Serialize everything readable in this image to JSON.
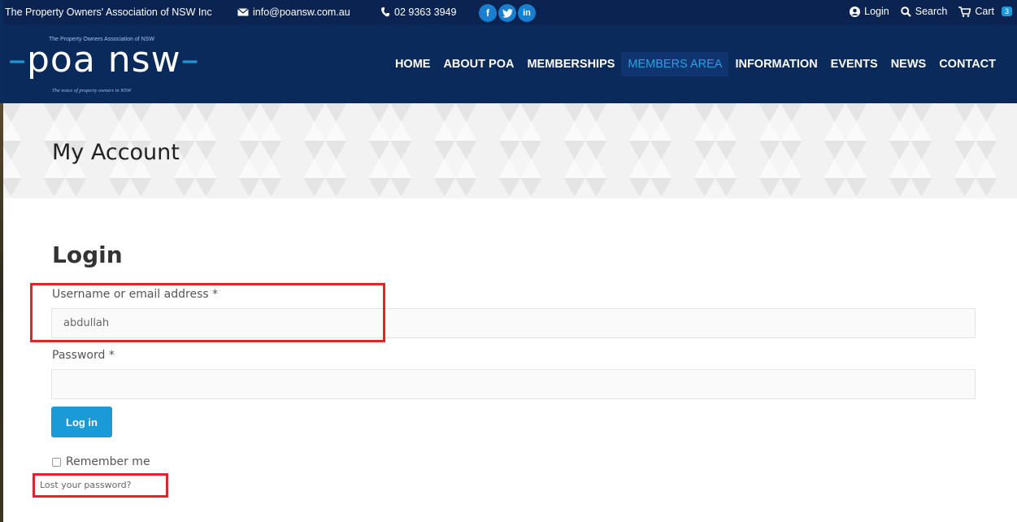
{
  "topbar": {
    "org_name": "The Property Owners' Association of NSW Inc",
    "email": "info@poansw.com.au",
    "phone": "02 9363 3949",
    "social": {
      "facebook": "f",
      "twitter": "t",
      "linkedin": "in"
    },
    "login": "Login",
    "search": "Search",
    "cart": "Cart",
    "cart_count": "3"
  },
  "logo": {
    "top_text": "The Property Owners Association of NSW",
    "mark": "poa nsw",
    "tagline": "The voice of property owners in NSW"
  },
  "nav": {
    "items": [
      "HOME",
      "ABOUT POA",
      "MEMBERSHIPS",
      "MEMBERS AREA",
      "INFORMATION",
      "EVENTS",
      "NEWS",
      "CONTACT"
    ],
    "active": "MEMBERS AREA"
  },
  "page": {
    "title": "My Account"
  },
  "login": {
    "heading": "Login",
    "username_label": "Username or email address *",
    "username_value": "abdullah",
    "password_label": "Password *",
    "password_value": "",
    "submit_label": "Log in",
    "remember_label": "Remember me",
    "lost_password": "Lost your password?"
  },
  "colors": {
    "topbar_bg": "#0b2350",
    "header_bg": "#0b2a5c",
    "accent": "#1a9ad6",
    "highlight": "#e0242c"
  }
}
